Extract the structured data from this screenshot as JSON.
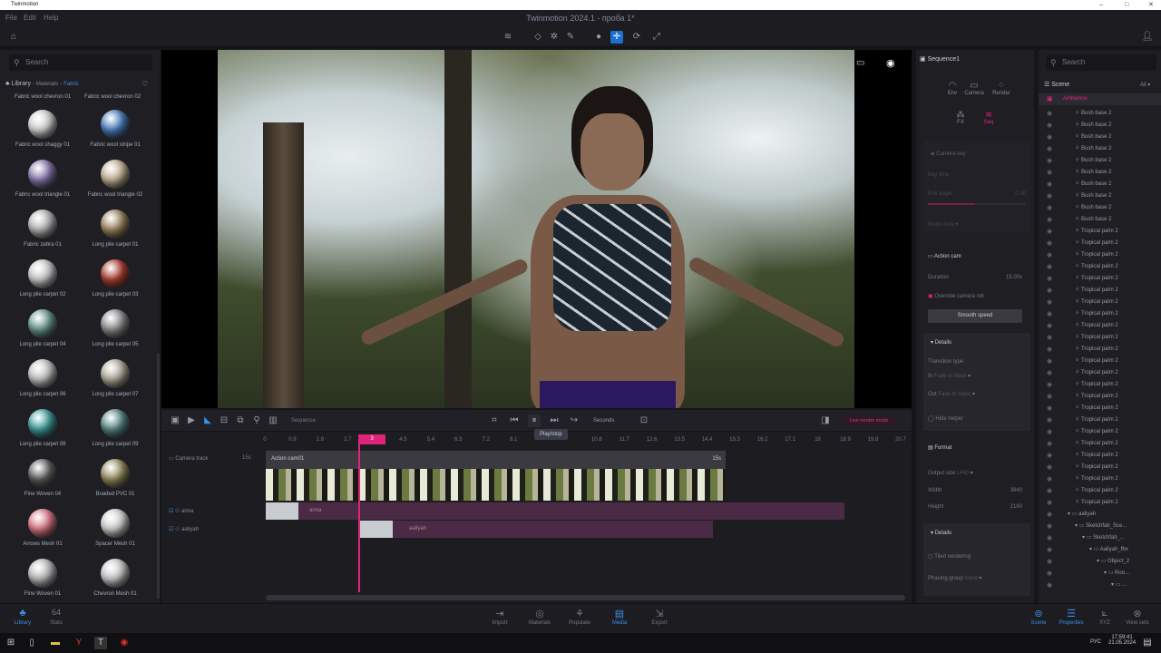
{
  "window": {
    "app_name": "Twinmotion",
    "title": "Twinmotion 2024.1 - проба 1*"
  },
  "menu": [
    "File",
    "Edit",
    "Help"
  ],
  "library": {
    "search_placeholder": "Search",
    "breadcrumb": [
      "Library",
      "Materials",
      "Fabric"
    ],
    "top_labels": [
      "Fabric wool chevron 01",
      "Fabric wool chevron 02"
    ],
    "items": [
      {
        "label": "Fabric wool shaggy 01",
        "color": "#d8d8d8"
      },
      {
        "label": "Fabric wool stripe 01",
        "color": "#4a7fc0"
      },
      {
        "label": "Fabric wool triangle 01",
        "color": "#8a7ab0"
      },
      {
        "label": "Fabric wool triangle 02",
        "color": "#c9b99a"
      },
      {
        "label": "Fabric zebra 01",
        "color": "#bbbbbb"
      },
      {
        "label": "Long pile carpet 01",
        "color": "#a08a60"
      },
      {
        "label": "Long pile carpet 02",
        "color": "#d0d0d0"
      },
      {
        "label": "Long pile carpet 03",
        "color": "#b04030"
      },
      {
        "label": "Long pile carpet 04",
        "color": "#6a9a90"
      },
      {
        "label": "Long pile carpet 05",
        "color": "#909090"
      },
      {
        "label": "Long pile carpet 06",
        "color": "#c8c8c8"
      },
      {
        "label": "Long pile carpet 07",
        "color": "#b8b0a0"
      },
      {
        "label": "Long pile carpet 08",
        "color": "#40a0a0"
      },
      {
        "label": "Long pile carpet 09",
        "color": "#5a8a88"
      },
      {
        "label": "Fine Woven 04",
        "color": "#606060"
      },
      {
        "label": "Braided PVC 01",
        "color": "#9a9060"
      },
      {
        "label": "Arrows Mesh 01",
        "color": "#e07a88"
      },
      {
        "label": "Spacer Mesh 01",
        "color": "#d8d8d8"
      },
      {
        "label": "Fine Woven 01",
        "color": "#c0c0c0"
      },
      {
        "label": "Chevron Mesh 01",
        "color": "#d0d0d0"
      }
    ]
  },
  "timeline": {
    "toolbar_label": "Sequence",
    "units": "Seconds",
    "tooltip": "Play/stop",
    "render_mode_btn": "Live render mode",
    "ticks": [
      "0",
      "0.9",
      "1.8",
      "2.7",
      "4.5",
      "5.4",
      "6.3",
      "7.2",
      "8.1",
      "10.8",
      "11.7",
      "12.6",
      "13.5",
      "14.4",
      "15.3",
      "16.2",
      "17.1",
      "18",
      "18.9",
      "19.8",
      "20.7"
    ],
    "playhead": "3",
    "camera_track": {
      "label": "Camera track",
      "duration": "15s",
      "clip": "Action cam01",
      "clip_duration": "15s"
    },
    "tracks": [
      {
        "label": "anna",
        "clip": "anna"
      },
      {
        "label": "aaliyah",
        "clip": "aaliyah"
      }
    ]
  },
  "properties": {
    "title": "Sequence1",
    "tabs": [
      "Env",
      "Camera",
      "Render",
      "FX",
      "Seq"
    ],
    "camera_key": {
      "title": "Camera key",
      "key_time": "Key time",
      "roll_angle": "Roll angle",
      "roll_value": "0.00",
      "mode_label": "Mode",
      "mode_value": "Auto"
    },
    "action_cam": {
      "title": "Action cam",
      "duration_label": "Duration",
      "duration": "15.00s",
      "override": "Override camera roll",
      "smooth": "Smooth speed"
    },
    "details1": {
      "title": "Details",
      "transition": "Transition type",
      "in_label": "In",
      "in_value": "Fade in black",
      "out_label": "Out",
      "out_value": "Fade to black",
      "hide_helper": "Hide helper"
    },
    "format": {
      "title": "Format",
      "output_label": "Output size",
      "output_value": "UHD",
      "width_label": "Width",
      "width": "3840",
      "height_label": "Height",
      "height": "2160"
    },
    "details2": {
      "title": "Details",
      "tiled": "Tiled rendering",
      "phasing_label": "Phasing group",
      "phasing_value": "None"
    }
  },
  "scene": {
    "search_placeholder": "Search",
    "title": "Scene",
    "filter": "All",
    "root": "Ambience",
    "items": [
      "Bush base 2",
      "Bush base 2",
      "Bush base 2",
      "Bush base 2",
      "Bush base 2",
      "Bush base 2",
      "Bush base 2",
      "Bush base 2",
      "Bush base 2",
      "Bush base 2",
      "Tropical palm 2",
      "Tropical palm 2",
      "Tropical palm 2",
      "Tropical palm 2",
      "Tropical palm 2",
      "Tropical palm 2",
      "Tropical palm 2",
      "Tropical palm 2",
      "Tropical palm 2",
      "Tropical palm 2",
      "Tropical palm 2",
      "Tropical palm 2",
      "Tropical palm 2",
      "Tropical palm 2",
      "Tropical palm 2",
      "Tropical palm 2",
      "Tropical palm 2",
      "Tropical palm 2",
      "Tropical palm 2",
      "Tropical palm 2",
      "Tropical palm 2",
      "Tropical palm 2",
      "Tropical palm 2",
      "Tropical palm 2"
    ],
    "tree": [
      "aaliyah",
      "Sketchfab_Sce...",
      "Sketchfab_...",
      "Aaliyah_fbx",
      "Object_2",
      "Roo...",
      "..."
    ]
  },
  "bottom": {
    "left": [
      {
        "label": "Library"
      },
      {
        "label": "Stats",
        "value": "64"
      }
    ],
    "center": [
      "Import",
      "Materials",
      "Populate",
      "Media",
      "Export"
    ],
    "active_center": "Media",
    "right": [
      "Scene",
      "Properties",
      "XYZ",
      "View sets"
    ]
  },
  "taskbar": {
    "lang": "РУС",
    "time": "17:59:41",
    "date": "21.05.2024"
  }
}
